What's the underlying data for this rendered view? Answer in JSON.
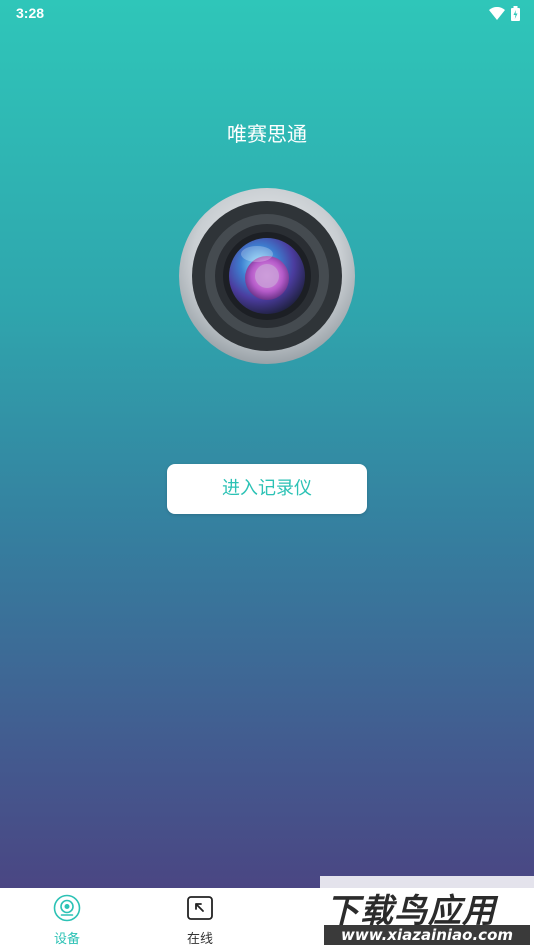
{
  "status_bar": {
    "time": "3:28"
  },
  "app": {
    "title": "唯赛思通"
  },
  "main": {
    "enter_button_label": "进入记录仪"
  },
  "bottom_nav": {
    "items": [
      {
        "label": "设备",
        "icon": "camera-device-icon",
        "active": true
      },
      {
        "label": "在线",
        "icon": "arrow-up-left-box-icon",
        "active": false
      }
    ]
  },
  "watermark": {
    "title": "下载鸟应用",
    "url": "www.xiazainiao.com"
  },
  "colors": {
    "accent": "#2cc2b5",
    "gradient_top": "#2fc6b9",
    "gradient_bottom": "#4a4683"
  }
}
